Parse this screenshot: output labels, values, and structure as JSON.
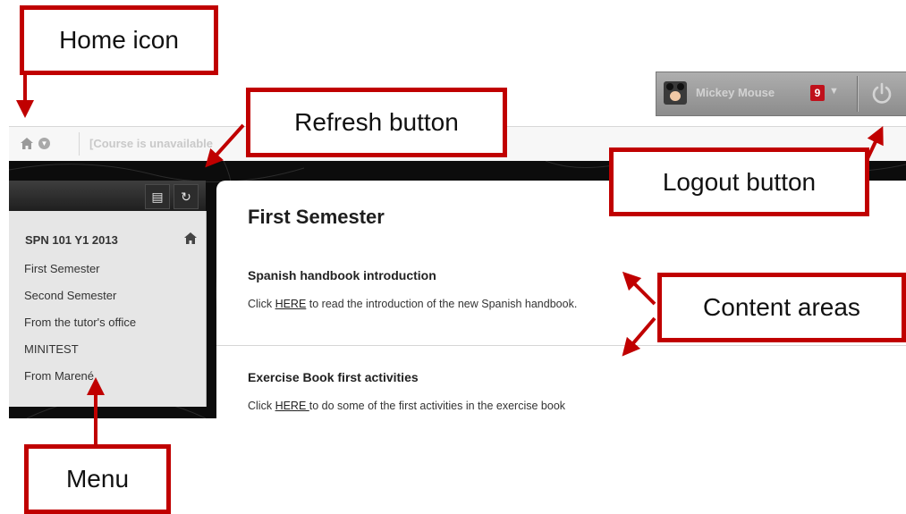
{
  "header": {
    "course_status": "[Course is unavailable"
  },
  "user": {
    "name": "Mickey Mouse",
    "notification_count": "9"
  },
  "course_menu": {
    "course_title": "SPN 101 Y1 2013",
    "items": [
      {
        "label": "First Semester"
      },
      {
        "label": "Second Semester"
      },
      {
        "label": "From the tutor's office"
      },
      {
        "label": "MINITEST"
      },
      {
        "label": "From Marené"
      }
    ]
  },
  "content": {
    "page_title": "First Semester",
    "items": [
      {
        "title": "Spanish handbook introduction",
        "desc_before": "Click ",
        "link_text": "HERE",
        "desc_after": " to read the introduction of the new Spanish handbook."
      },
      {
        "title": "Exercise Book first activities",
        "desc_before": "Click ",
        "link_text": "HERE ",
        "desc_after": "to do some of the first activities in the exercise book"
      }
    ]
  },
  "annotations": {
    "home_icon": "Home icon",
    "refresh_button": "Refresh button",
    "logout_button": "Logout button",
    "content_areas": "Content areas",
    "menu": "Menu"
  },
  "colors": {
    "annotation_red": "#c00000",
    "notification_badge": "#c0111b"
  }
}
